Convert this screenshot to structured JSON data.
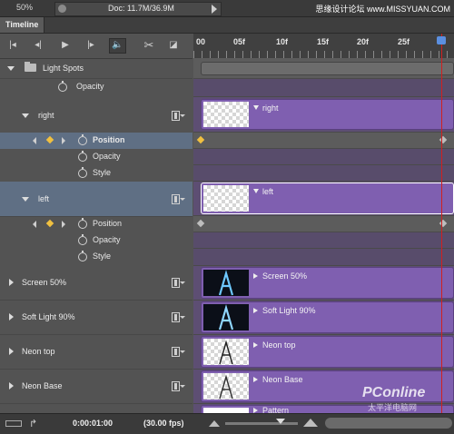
{
  "status": {
    "zoom": "50%",
    "doc": "Doc: 11.7M/36.9M",
    "watermark": "思缘设计论坛 www.MISSYUAN.COM"
  },
  "panel": {
    "tab_label": "Timeline"
  },
  "ruler": {
    "ticks": [
      "00",
      "05f",
      "10f",
      "15f",
      "20f",
      "25f",
      "01:00"
    ]
  },
  "layers": [
    {
      "name": "Light Spots",
      "expanded": true,
      "is_group": true
    },
    {
      "name": "right",
      "expanded": true,
      "clip": "right"
    },
    {
      "name": "left",
      "expanded": true,
      "clip": "left",
      "selected": true
    },
    {
      "name": "Screen 50%",
      "expanded": false,
      "clip": "Screen 50%"
    },
    {
      "name": "Soft Light 90%",
      "expanded": false,
      "clip": "Soft Light 90%"
    },
    {
      "name": "Neon top",
      "expanded": false,
      "clip": "Neon top"
    },
    {
      "name": "Neon Base",
      "expanded": false,
      "clip": "Neon Base"
    },
    {
      "name": "",
      "clip": "Pattern"
    }
  ],
  "props": {
    "opacity": "Opacity",
    "position": "Position",
    "style": "Style"
  },
  "bottom": {
    "timecode": "0:00:01:00",
    "fps": "(30.00 fps)"
  },
  "watermark2": "PConline",
  "watermark2_sub": "太平洋电脑网"
}
